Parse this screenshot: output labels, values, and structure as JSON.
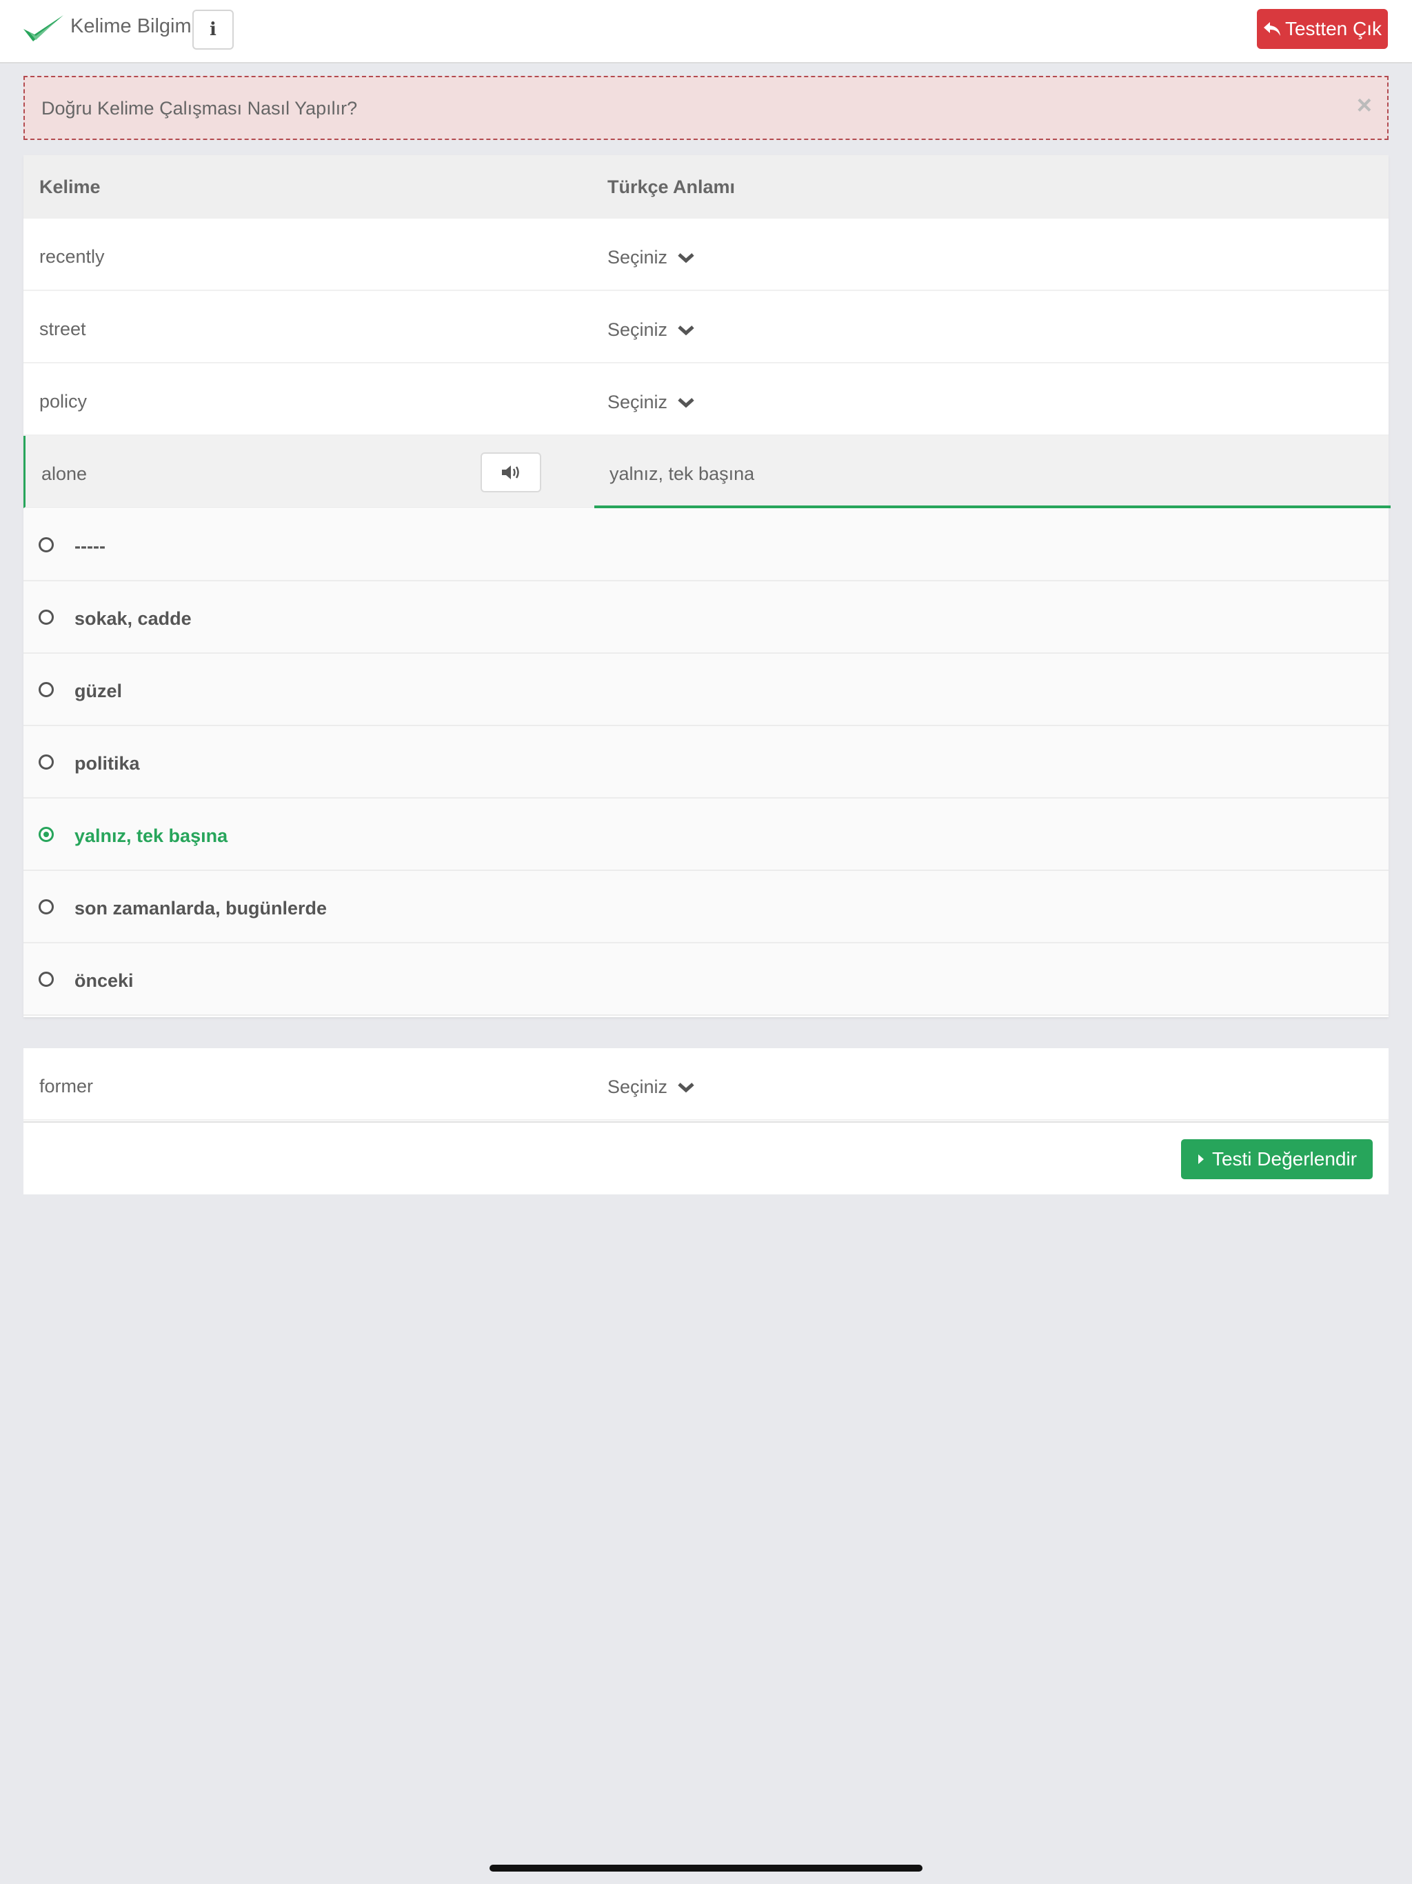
{
  "header": {
    "app_title": "Kelime Bilgim",
    "info_icon": "info-icon",
    "exit_label": "Testten Çık",
    "exit_color": "#d9393e"
  },
  "alert": {
    "text": "Doğru Kelime Çalışması Nasıl Yapılır?",
    "close_glyph": "×"
  },
  "table": {
    "col_word": "Kelime",
    "col_meaning": "Türkçe Anlamı",
    "rows": [
      {
        "word": "recently",
        "select": "Seçiniz"
      },
      {
        "word": "street",
        "select": "Seçiniz"
      },
      {
        "word": "policy",
        "select": "Seçiniz"
      }
    ],
    "active_row": {
      "word": "alone",
      "answer": "yalnız, tek başına"
    },
    "options": [
      {
        "label": "-----",
        "checked": false
      },
      {
        "label": "sokak, cadde",
        "checked": false
      },
      {
        "label": "güzel",
        "checked": false
      },
      {
        "label": "politika",
        "checked": false
      },
      {
        "label": "yalnız, tek başına",
        "checked": true
      },
      {
        "label": "son zamanlarda, bugünlerde",
        "checked": false
      },
      {
        "label": "önceki",
        "checked": false
      }
    ],
    "last_row": {
      "word": "former",
      "select": "Seçiniz"
    }
  },
  "footer": {
    "evaluate_label": "Testi Değerlendir",
    "evaluate_color": "#27a55b"
  }
}
